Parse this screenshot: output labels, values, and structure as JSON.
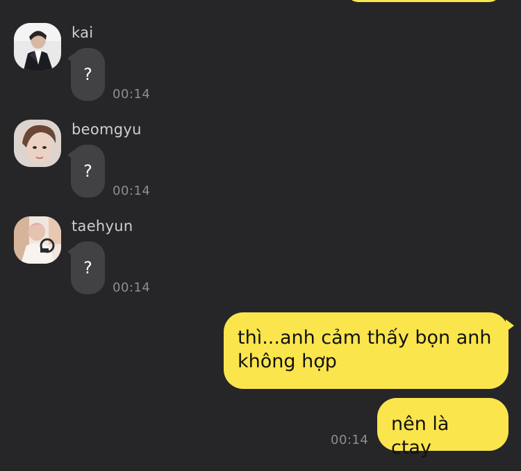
{
  "messages": [
    {
      "sender": "kai",
      "text": "?",
      "time": "00:14",
      "avatar": "kai-avatar"
    },
    {
      "sender": "beomgyu",
      "text": "?",
      "time": "00:14",
      "avatar": "beomgyu-avatar"
    },
    {
      "sender": "taehyun",
      "text": "?",
      "time": "00:14",
      "avatar": "taehyun-avatar"
    }
  ],
  "outgoing": [
    {
      "line1": "thì...anh cảm thấy bọn anh",
      "line2": "không hợp"
    },
    {
      "text": "nên là ctay",
      "time": "00:14"
    }
  ],
  "colors": {
    "background": "#262628",
    "incoming_bubble": "#424245",
    "outgoing_bubble": "#fbe54d",
    "timestamp": "#8e8e92"
  }
}
